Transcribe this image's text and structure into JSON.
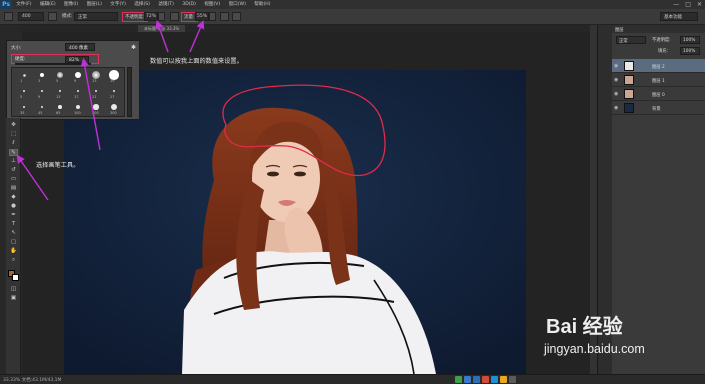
{
  "app": {
    "logo": "Ps"
  },
  "menu": [
    "文件(F)",
    "编辑(E)",
    "图像(I)",
    "图层(L)",
    "文字(Y)",
    "选择(S)",
    "滤镜(T)",
    "3D(D)",
    "视图(V)",
    "窗口(W)",
    "帮助(H)"
  ],
  "window_controls": [
    "—",
    "□",
    "✕"
  ],
  "options": {
    "brush_size": "400",
    "mode_label": "模式:",
    "mode_value": "正常",
    "opacity_label": "不透明度:",
    "opacity_value": "72%",
    "flow_label": "流量:",
    "flow_value": "55%"
  },
  "doc_tab": "未标题-1 @ 33.3%",
  "brush_panel": {
    "size_label": "大小:",
    "size_value": "400 像素",
    "hardness_label": "硬度:",
    "hardness_value": "82%",
    "brush_rows": [
      [
        "1",
        "3",
        "5",
        "9",
        "13",
        "19"
      ],
      [
        "5",
        "9",
        "13",
        "17",
        "21",
        "27"
      ],
      [
        "35",
        "45",
        "65",
        "100",
        "200",
        "300"
      ]
    ]
  },
  "annotations": {
    "top": "数值可以按我上面的数值来设置。",
    "left": "选择画笔工具。"
  },
  "panels": {
    "tab": "图层",
    "workspace": "基本功能",
    "mode": "正常",
    "opacity_label": "不透明度:",
    "opacity_value": "100%",
    "fill_label": "填充:",
    "fill_value": "100%",
    "layers": [
      {
        "name": "图层 2",
        "selected": true
      },
      {
        "name": "图层 1",
        "selected": false
      },
      {
        "name": "图层 0",
        "selected": false
      },
      {
        "name": "背景",
        "selected": false
      }
    ]
  },
  "status": {
    "zoom_doc": "33.33%  文档:43.1M/43.1M"
  },
  "watermark": {
    "brand": "Bai 经验",
    "url": "jingyan.baidu.com"
  },
  "colors": {
    "highlight": "#e0305a",
    "arrow": "#c030d8",
    "canvas_bg": "#12213a"
  }
}
